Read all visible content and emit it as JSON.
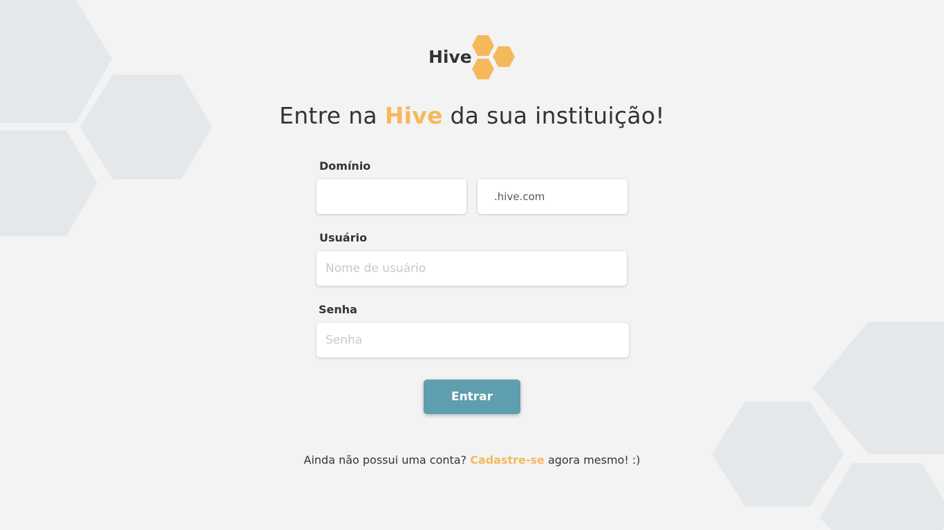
{
  "brand": {
    "name": "Hive",
    "accent_color": "#f5b95c",
    "logo_icon": "honeycomb-icon"
  },
  "headline": {
    "prefix": "Entre na ",
    "highlight": "Hive",
    "suffix": " da sua instituição!"
  },
  "form": {
    "domain": {
      "label": "Domínio",
      "value": "",
      "placeholder": "",
      "suffix": ".hive.com"
    },
    "user": {
      "label": "Usuário",
      "value": "",
      "placeholder": "Nome de usuário"
    },
    "password": {
      "label": "Senha",
      "value": "",
      "placeholder": "Senha"
    },
    "submit_label": "Entrar",
    "submit_color": "#5e9eaf"
  },
  "signup": {
    "prefix": "Ainda não possui uma conta? ",
    "link": "Cadastre-se",
    "suffix": " agora mesmo! :)"
  },
  "colors": {
    "background": "#f3f3f3",
    "decor_hexagons": "#e4e8ea"
  }
}
